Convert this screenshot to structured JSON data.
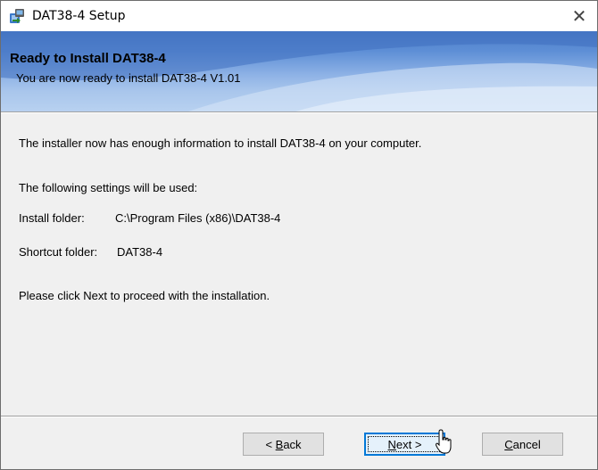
{
  "window": {
    "title": "DAT38-4 Setup",
    "close_glyph": "✕",
    "app_icon": "setup-icon",
    "close_icon": "close-icon"
  },
  "banner": {
    "title": "Ready to Install DAT38-4",
    "subtitle": "You are now ready to install DAT38-4 V1.01"
  },
  "content": {
    "intro": "The installer now has enough information to install DAT38-4 on your computer.",
    "settings_heading": "The following settings will be used:",
    "install_folder_label": "Install folder:",
    "install_folder_value": "C:\\Program Files (x86)\\DAT38-4",
    "shortcut_folder_label": "Shortcut folder:",
    "shortcut_folder_value": "DAT38-4",
    "proceed_text": "Please click Next to proceed with the installation."
  },
  "buttons": {
    "back_prefix": "< ",
    "back_accel": "B",
    "back_rest": "ack",
    "next_accel": "N",
    "next_rest": "ext >",
    "cancel_accel": "C",
    "cancel_rest": "ancel"
  },
  "colors": {
    "accent": "#0078d7",
    "banner_top": "#4a7bc8",
    "banner_bottom": "#b8d1f0"
  }
}
